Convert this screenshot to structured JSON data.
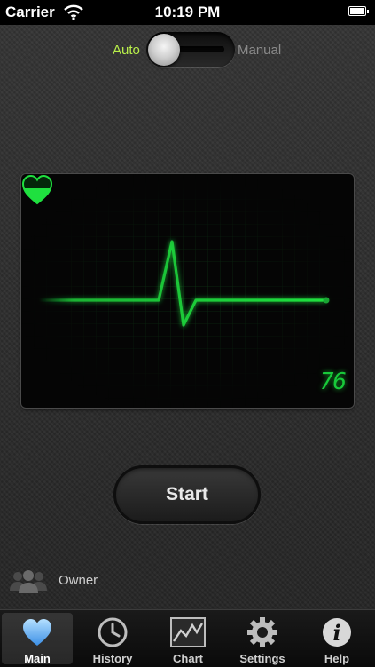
{
  "status_bar": {
    "carrier": "Carrier",
    "time": "10:19 PM"
  },
  "mode": {
    "auto_label": "Auto",
    "manual_label": "Manual",
    "selected": "Auto"
  },
  "monitor": {
    "bpm": "76"
  },
  "start_button": {
    "label": "Start"
  },
  "owner": {
    "label": "Owner"
  },
  "tabs": [
    {
      "label": "Main",
      "icon": "heart-icon",
      "active": true
    },
    {
      "label": "History",
      "icon": "clock-icon"
    },
    {
      "label": "Chart",
      "icon": "chart-icon"
    },
    {
      "label": "Settings",
      "icon": "gear-icon"
    },
    {
      "label": "Help",
      "icon": "info-icon"
    }
  ],
  "colors": {
    "accent_green": "#1fe03f",
    "auto_label": "#b8ef4a",
    "active_tab_icon": "#6fb6ff"
  }
}
